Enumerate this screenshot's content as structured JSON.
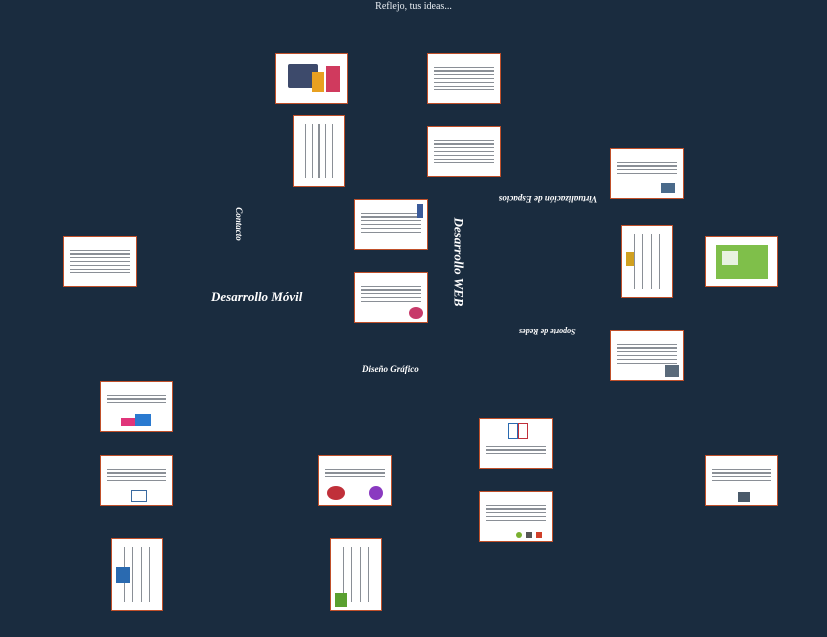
{
  "caption": "Reflejo, tus ideas...",
  "labels": {
    "desarrollo_movil": "Desarrollo Móvil",
    "desarrollo_web": "Desarrollo WEB",
    "contacto": "Contacto",
    "virtualizacion": "Virtualización de Espacios",
    "soporte_redes": "Soporte de Redes",
    "diseno_grafico": "Diseño Gráfico"
  },
  "colors": {
    "background": "#1a2c3f",
    "frame_border": "#c0502a"
  }
}
